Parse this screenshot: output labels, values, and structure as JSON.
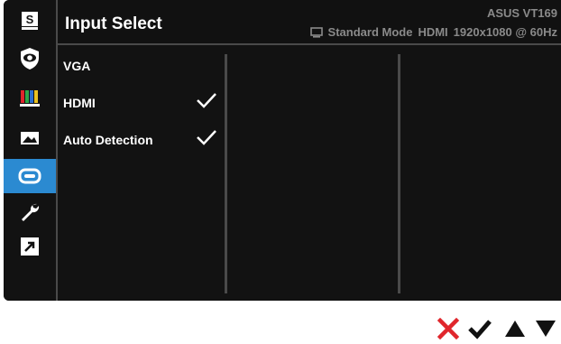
{
  "header": {
    "title": "Input Select",
    "model": "ASUS VT169",
    "mode": "Standard Mode",
    "input": "HDMI",
    "resolution": "1920x1080 @ 60Hz"
  },
  "sidebar": {
    "items": [
      {
        "name": "splendid",
        "icon": "s-letter-icon"
      },
      {
        "name": "eye-care",
        "icon": "eye-shield-icon"
      },
      {
        "name": "color",
        "icon": "color-bars-icon"
      },
      {
        "name": "image",
        "icon": "image-icon"
      },
      {
        "name": "input-select",
        "icon": "input-port-icon",
        "active": true
      },
      {
        "name": "system-setup",
        "icon": "wrench-icon"
      },
      {
        "name": "shortcut",
        "icon": "arrow-shortcut-icon"
      }
    ]
  },
  "options": [
    {
      "label": "VGA",
      "checked": false
    },
    {
      "label": "HDMI",
      "checked": true
    },
    {
      "label": "Auto Detection",
      "checked": true
    }
  ],
  "keys": [
    {
      "name": "close",
      "icon": "x-icon",
      "color": "#e0262c"
    },
    {
      "name": "confirm",
      "icon": "check-icon"
    },
    {
      "name": "up",
      "icon": "triangle-up-icon"
    },
    {
      "name": "down",
      "icon": "triangle-down-icon"
    }
  ],
  "colors": {
    "accent": "#2b8ad1",
    "background": "#121212",
    "divider": "#4a4a4a",
    "muted_text": "#8a8a8a"
  }
}
